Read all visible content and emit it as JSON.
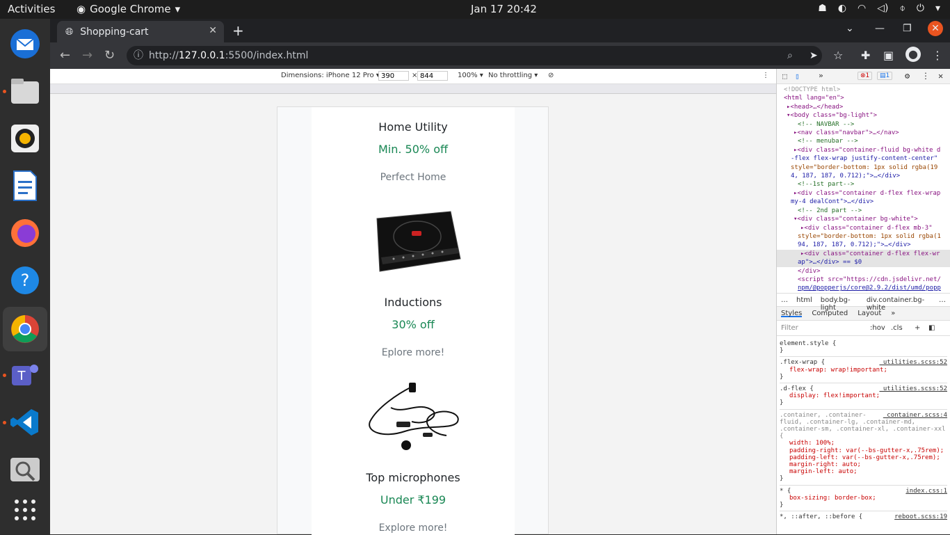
{
  "system": {
    "activities": "Activities",
    "app_name": "Google Chrome",
    "clock": "Jan 17  20:42"
  },
  "browser": {
    "tab_title": "Shopping-cart",
    "url_prefix": "http://",
    "url_host": "127.0.0.1",
    "url_rest": ":5500/index.html"
  },
  "device_toolbar": {
    "dimensions_label": "Dimensions: iPhone 12 Pro ▾",
    "width": "390",
    "times": "×",
    "height": "844",
    "zoom": "100% ▾",
    "throttling": "No throttling ▾"
  },
  "products": [
    {
      "title": "Home Utility",
      "deal": "Min. 50% off",
      "sub": "Perfect Home"
    },
    {
      "title": "Inductions",
      "deal": "30% off",
      "sub": "Eplore more!"
    },
    {
      "title": "Top microphones",
      "deal": "Under ₹199",
      "sub": "Explore more!"
    }
  ],
  "devtools": {
    "errors": "1",
    "messages": "1",
    "dom_lines": [
      "<!DOCTYPE html>",
      "<html lang=\"en\">",
      "▸<head>…</head>",
      "▾<body class=\"bg-light\">",
      "<!-- NAVBAR -->",
      "▸<nav class=\"navbar\">…</nav>",
      "<!-- menubar -->",
      "▸<div class=\"container-fluid bg-white d",
      "-flex flex-wrap justify-content-center\"",
      "style=\"border-bottom: 1px solid rgba(19",
      "4, 187, 187, 0.712);\">…</div>",
      "<!--1st part-->",
      "▸<div class=\"container d-flex flex-wrap",
      "my-4 dealCont\">…</div>",
      "<!-- 2nd part -->",
      "▾<div class=\"container bg-white\">",
      "▸<div class=\"container d-flex mb-3\"",
      "style=\"border-bottom: 1px solid rgba(1",
      "94, 187, 187, 0.712);\">…</div>",
      "▸<div class=\"container d-flex flex-wr",
      "ap\">…</div>  == $0",
      "</div>",
      "<script src=\"https://cdn.jsdelivr.net/",
      "npm/@popperjs/core@2.9.2/dist/umd/popp"
    ],
    "breadcrumbs": [
      "…",
      "html",
      "body.bg-light",
      "div.container.bg-white",
      "…"
    ],
    "style_tabs": [
      "Styles",
      "Computed",
      "Layout",
      "»"
    ],
    "filter_placeholder": "Filter",
    "hov": ":hov",
    "cls": ".cls",
    "rules": [
      {
        "selector": "element.style {",
        "source": "",
        "props": [],
        "close": "}"
      },
      {
        "selector": ".flex-wrap {",
        "source": "_utilities.scss:52",
        "props": [
          "flex-wrap: wrap!important;"
        ],
        "close": "}"
      },
      {
        "selector": ".d-flex {",
        "source": "_utilities.scss:52",
        "props": [
          "display: flex!important;"
        ],
        "close": "}"
      },
      {
        "selector": ".container, .container-fluid, .container-lg, .container-md, .container-sm, .container-xl, .container-xxl {",
        "source": "_container.scss:4",
        "props": [
          "width: 100%;",
          "padding-right: var(--bs-gutter-x,.75rem);",
          "padding-left: var(--bs-gutter-x,.75rem);",
          "margin-right: auto;",
          "margin-left: auto;"
        ],
        "close": "}"
      },
      {
        "selector": "* {",
        "source": "index.css:1",
        "props": [
          "box-sizing: border-box;"
        ],
        "close": "}"
      },
      {
        "selector": "*, ::after, ::before {",
        "source": "reboot.scss:19",
        "props": [],
        "close": ""
      }
    ]
  }
}
